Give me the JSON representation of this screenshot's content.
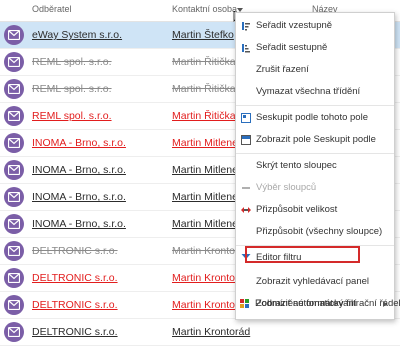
{
  "header": {
    "col1": "Odběratel",
    "col2": "Kontaktní osoba",
    "col3": "Název"
  },
  "rows": [
    {
      "company": "eWay System s.r.o.",
      "contact": "Martin Štefko",
      "style": "normal",
      "selected": true
    },
    {
      "company": "REML spol. s.r.o.",
      "contact": "Martin Řitička",
      "style": "struck",
      "selected": false
    },
    {
      "company": "REML spol. s.r.o.",
      "contact": "Martin Řitička",
      "style": "struck",
      "selected": false
    },
    {
      "company": "REML spol. s.r.o.",
      "contact": "Martin Řitička",
      "style": "red",
      "selected": false
    },
    {
      "company": "INOMA - Brno, s.r.o.",
      "contact": "Martin Mitlener",
      "style": "red",
      "selected": false
    },
    {
      "company": "INOMA - Brno, s.r.o.",
      "contact": "Martin Mitlener",
      "style": "normal",
      "selected": false
    },
    {
      "company": "INOMA - Brno, s.r.o.",
      "contact": "Martin Mitlener",
      "style": "normal",
      "selected": false
    },
    {
      "company": "INOMA - Brno, s.r.o.",
      "contact": "Martin Mitlener",
      "style": "normal",
      "selected": false
    },
    {
      "company": "DELTRONIC s.r.o.",
      "contact": "Martin Krontorád",
      "style": "struck",
      "selected": false
    },
    {
      "company": "DELTRONIC s.r.o.",
      "contact": "Martin Krontorád",
      "style": "red",
      "selected": false
    },
    {
      "company": "DELTRONIC s.r.o.",
      "contact": "Martin Krontorád",
      "style": "red",
      "selected": false
    },
    {
      "company": "DELTRONIC s.r.o.",
      "contact": "Martin Krontorád",
      "style": "normal",
      "selected": false
    }
  ],
  "menu": {
    "sort_asc": "Seřadit vzestupně",
    "sort_desc": "Seřadit sestupně",
    "clear_sort": "Zrušit řazení",
    "clear_all_sorts": "Vymazat všechna třídění",
    "group_by": "Seskupit podle tohoto pole",
    "show_group_field": "Zobrazit pole Seskupit podle",
    "hide_column": "Skrýt tento sloupec",
    "choose_columns": "Výběr sloupců",
    "best_fit": "Přizpůsobit velikost",
    "best_fit_all": "Přizpůsobit (všechny sloupce)",
    "filter_editor": "Editor filtru",
    "show_find_panel": "Zobrazit vyhledávací panel",
    "show_auto_filter": "Zobrazit automatický filtrační řádek",
    "conditional_format": "Podmíněné formátování"
  },
  "colors": {
    "avatar": "#7b5ea7",
    "selected_row": "#cfe4f6",
    "red_text": "#e21d1d",
    "highlight_border": "#d42a2a",
    "sort_icon_blue": "#2a6ebd"
  }
}
